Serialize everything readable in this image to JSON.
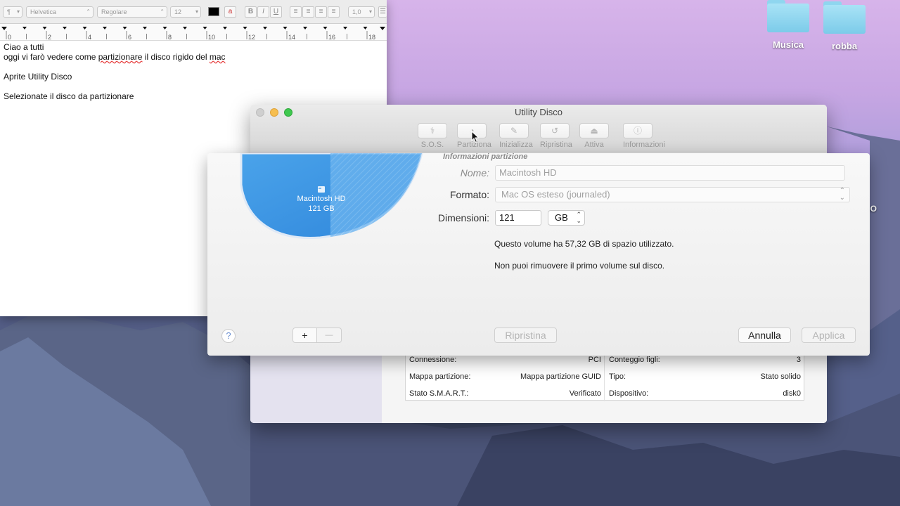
{
  "desktop": {
    "folders": [
      {
        "label": "Musica"
      },
      {
        "label": "robba"
      }
    ],
    "partial_label": "NO"
  },
  "textedit": {
    "toolbar": {
      "paragraph": "¶",
      "font_family": "Helvetica",
      "font_style": "Regolare",
      "font_size": "12",
      "bold": "B",
      "italic": "I",
      "underline": "U",
      "line_spacing": "1,0"
    },
    "ruler_numbers": [
      "0",
      "2",
      "4",
      "6",
      "8",
      "10",
      "12",
      "14",
      "16",
      "18"
    ],
    "lines": {
      "l1": "Ciao a tutti",
      "l2_pre": "oggi vi farò vedere come ",
      "l2_word": "partizionare",
      "l2_mid": " il disco rigido del ",
      "l2_end": "mac",
      "l3": "Aprite Utility Disco",
      "l4": "Selezionate il disco da partizionare"
    }
  },
  "disk_utility": {
    "title": "Utility Disco",
    "toolbar": [
      {
        "label": "S.O.S.",
        "icon": "stethoscope-icon"
      },
      {
        "label": "Partiziona",
        "icon": "partition-icon"
      },
      {
        "label": "Inizializza",
        "icon": "erase-icon"
      },
      {
        "label": "Ripristina",
        "icon": "restore-icon"
      },
      {
        "label": "Attiva",
        "icon": "mount-icon"
      },
      {
        "label": "Informazioni",
        "icon": "info-icon"
      }
    ],
    "info": {
      "connessione_label": "Connessione:",
      "connessione_value": "PCI",
      "conteggio_label": "Conteggio figli:",
      "conteggio_value": "3",
      "mappa_label": "Mappa partizione:",
      "mappa_value": "Mappa partizione GUID",
      "tipo_label": "Tipo:",
      "tipo_value": "Stato solido",
      "smart_label": "Stato S.M.A.R.T.:",
      "smart_value": "Verificato",
      "dispositivo_label": "Dispositivo:",
      "dispositivo_value": "disk0"
    }
  },
  "partition_sheet": {
    "section_header": "Informazioni partizione",
    "pie": {
      "name": "Macintosh HD",
      "size": "121 GB"
    },
    "nome_label": "Nome:",
    "nome_value": "Macintosh HD",
    "formato_label": "Formato:",
    "formato_value": "Mac OS esteso (journaled)",
    "dimensioni_label": "Dimensioni:",
    "dimensioni_value": "121",
    "unit_value": "GB",
    "message_used": "Questo volume ha 57,32 GB di spazio utilizzato.",
    "message_remove": "Non puoi rimuovere il primo volume sul disco.",
    "help_label": "?",
    "add_label": "+",
    "remove_label": "—",
    "ripristina_label": "Ripristina",
    "annulla_label": "Annulla",
    "applica_label": "Applica"
  },
  "colors": {
    "pie_blue": "#3f98e6",
    "accent": "#6b8fd1"
  }
}
